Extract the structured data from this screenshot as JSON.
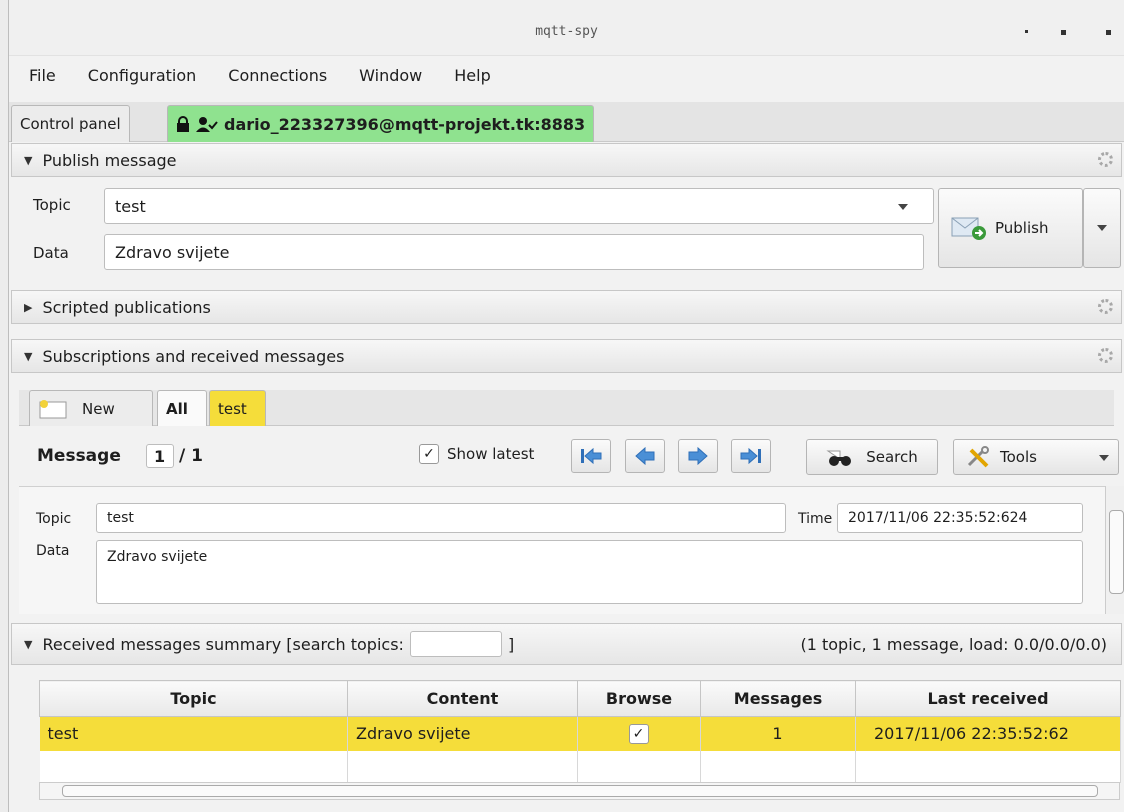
{
  "window": {
    "title": "mqtt-spy"
  },
  "menu": [
    "File",
    "Configuration",
    "Connections",
    "Window",
    "Help"
  ],
  "tabs": {
    "control_panel": "Control panel",
    "connection": "dario_223327396@mqtt-projekt.tk:8883",
    "connection_color": "#8fe28f"
  },
  "publish": {
    "header": "Publish message",
    "topic_label": "Topic",
    "topic_value": "test",
    "data_label": "Data",
    "data_value": "Zdravo svijete",
    "publish_button": "Publish"
  },
  "scripted": {
    "header": "Scripted publications"
  },
  "subscriptions": {
    "header": "Subscriptions and received messages",
    "tabs": {
      "new": "New",
      "all": "All",
      "test": "test",
      "test_color": "#f5dd3a"
    },
    "message_label": "Message",
    "message_index": "1",
    "message_total": "/ 1",
    "show_latest": "Show latest",
    "show_latest_checked": true,
    "search_button": "Search",
    "tools_button": "Tools",
    "detail": {
      "topic_label": "Topic",
      "topic_value": "test",
      "time_label": "Time",
      "time_value": "2017/11/06 22:35:52:624",
      "data_label": "Data",
      "data_value": "Zdravo svijete"
    }
  },
  "summary": {
    "header_prefix": "Received messages summary [search topics:",
    "header_suffix": "]",
    "stats": "(1 topic, 1 message, load: 0.0/0.0/0.0)",
    "columns": [
      "Topic",
      "Content",
      "Browse",
      "Messages",
      "Last received"
    ],
    "rows": [
      {
        "topic": "test",
        "content": "Zdravo svijete",
        "browse": true,
        "messages": "1",
        "last_received": "2017/11/06 22:35:52:62"
      }
    ]
  }
}
